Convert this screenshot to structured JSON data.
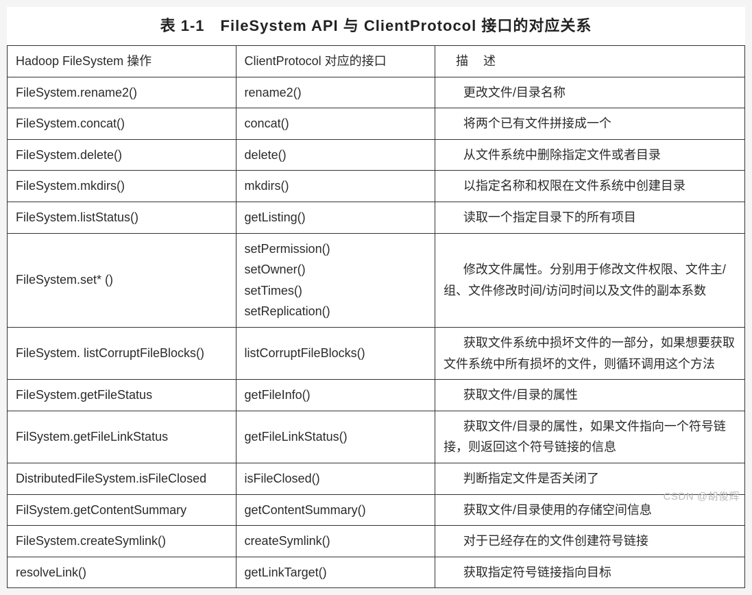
{
  "title": "表 1-1　FileSystem API 与 ClientProtocol 接口的对应关系",
  "headers": {
    "col1": "Hadoop FileSystem 操作",
    "col2": "ClientProtocol 对应的接口",
    "col3": "描述"
  },
  "rows": [
    {
      "fs": "FileSystem.rename2()",
      "cp": "rename2()",
      "desc": "更改文件/目录名称"
    },
    {
      "fs": "FileSystem.concat()",
      "cp": "concat()",
      "desc": "将两个已有文件拼接成一个"
    },
    {
      "fs": "FileSystem.delete()",
      "cp": "delete()",
      "desc": "从文件系统中删除指定文件或者目录"
    },
    {
      "fs": "FileSystem.mkdirs()",
      "cp": "mkdirs()",
      "desc": "以指定名称和权限在文件系统中创建目录"
    },
    {
      "fs": "FileSystem.listStatus()",
      "cp": "getListing()",
      "desc": "读取一个指定目录下的所有项目"
    },
    {
      "fs": "FileSystem.set* ()",
      "cp": "setPermission()\nsetOwner()\nsetTimes()\nsetReplication()",
      "desc": "修改文件属性。分别用于修改文件权限、文件主/组、文件修改时间/访问时间以及文件的副本系数"
    },
    {
      "fs": "FileSystem. listCorruptFileBlocks()",
      "cp": "listCorruptFileBlocks()",
      "desc": "获取文件系统中损坏文件的一部分，如果想要获取文件系统中所有损坏的文件，则循环调用这个方法"
    },
    {
      "fs": "FileSystem.getFileStatus",
      "cp": "getFileInfo()",
      "desc": "获取文件/目录的属性"
    },
    {
      "fs": "FilSystem.getFileLinkStatus",
      "cp": "getFileLinkStatus()",
      "desc": "获取文件/目录的属性，如果文件指向一个符号链接，则返回这个符号链接的信息"
    },
    {
      "fs": "DistributedFileSystem.isFileClosed",
      "cp": "isFileClosed()",
      "desc": "判断指定文件是否关闭了"
    },
    {
      "fs": "FilSystem.getContentSummary",
      "cp": "getContentSummary()",
      "desc": "获取文件/目录使用的存储空间信息"
    },
    {
      "fs": "FileSystem.createSymlink()",
      "cp": "createSymlink()",
      "desc": "对于已经存在的文件创建符号链接"
    },
    {
      "fs": "resolveLink()",
      "cp": "getLinkTarget()",
      "desc": "获取指定符号链接指向目标"
    }
  ],
  "watermark": "CSDN @胡俊辉"
}
